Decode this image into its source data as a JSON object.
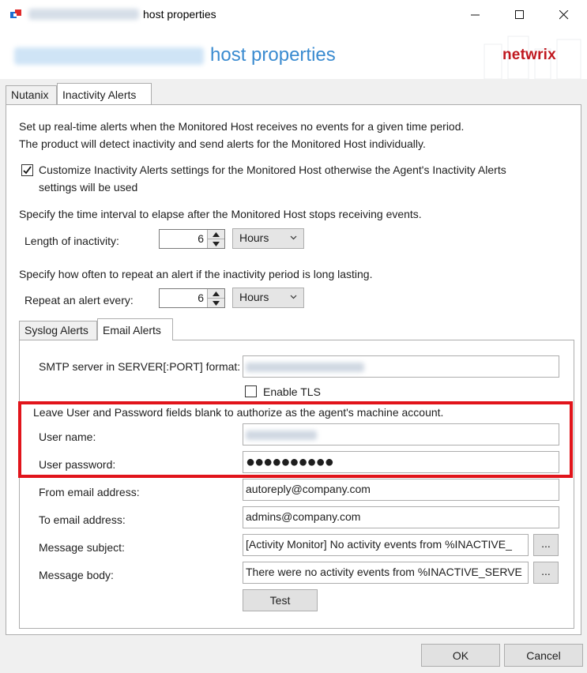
{
  "window": {
    "title": "host properties",
    "header_title": "host properties",
    "brand": "netwrix",
    "brand_color": "#c0181f",
    "accent_color": "#3a8bd0"
  },
  "tabs": [
    {
      "label": "Nutanix"
    },
    {
      "label": "Inactivity Alerts"
    }
  ],
  "inactivity": {
    "intro_line1": "Set up real-time alerts when the Monitored Host receives no events for a given time period.",
    "intro_line2": "The product will detect inactivity and send alerts for the Monitored Host individually.",
    "customize_line1": "Customize Inactivity Alerts settings for the Monitored Host otherwise the Agent's Inactivity Alerts",
    "customize_line2": "settings will be used",
    "customize_checked": true,
    "interval_text": "Specify the time interval to elapse after the Monitored Host stops receiving events.",
    "length_label": "Length of inactivity:",
    "length_value": "6",
    "length_unit": "Hours",
    "repeat_text": "Specify how often to repeat an alert if the inactivity period is long lasting.",
    "repeat_label": "Repeat an alert every:",
    "repeat_value": "6",
    "repeat_unit": "Hours"
  },
  "subtabs": [
    {
      "label": "Syslog Alerts"
    },
    {
      "label": "Email Alerts"
    }
  ],
  "email": {
    "smtp_label": "SMTP server in SERVER[:PORT] format:",
    "tls_label": "Enable TLS",
    "tls_checked": false,
    "blank_note": "Leave User and Password fields blank to authorize as the agent's machine account.",
    "user_label": "User name:",
    "password_label": "User password:",
    "password_value": "●●●●●●●●●●",
    "from_label": "From email address:",
    "from_value": "autoreply@company.com",
    "to_label": "To email address:",
    "to_value": "admins@company.com",
    "subject_label": "Message subject:",
    "subject_value": "[Activity Monitor] No activity events from %INACTIVE_",
    "body_label": "Message body:",
    "body_value": "There were no activity events from %INACTIVE_SERVE",
    "browse_label": "...",
    "test_label": "Test"
  },
  "footer": {
    "ok_label": "OK",
    "cancel_label": "Cancel"
  },
  "highlight_color": "#e1141b"
}
